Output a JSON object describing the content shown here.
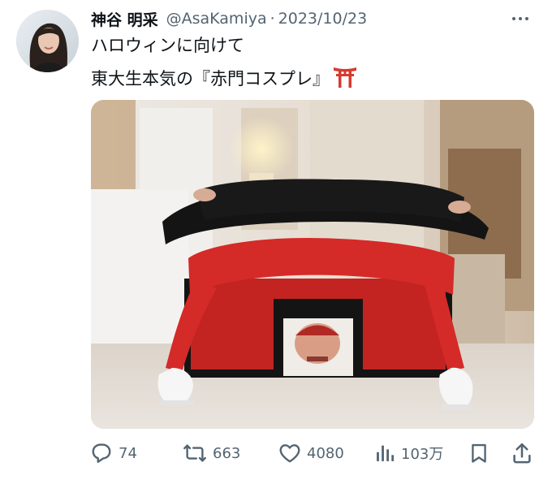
{
  "tweet": {
    "author_name": "神谷 明采",
    "handle": "@AsaKamiya",
    "separator": "·",
    "date": "2023/10/23",
    "text_line1": "ハロウィンに向けて",
    "text_line2": "東大生本気の『赤門コスプレ』",
    "emoji": "torii-gate-emoji"
  },
  "stats": {
    "replies": "74",
    "retweets": "663",
    "likes": "4080",
    "views": "103万"
  },
  "colors": {
    "text": "#0f1419",
    "muted": "#536471",
    "costume_red": "#d42a28",
    "coat_black": "#141414"
  },
  "icons": [
    "more-icon",
    "reply-icon",
    "retweet-icon",
    "like-icon",
    "views-icon",
    "bookmark-icon",
    "share-icon"
  ]
}
